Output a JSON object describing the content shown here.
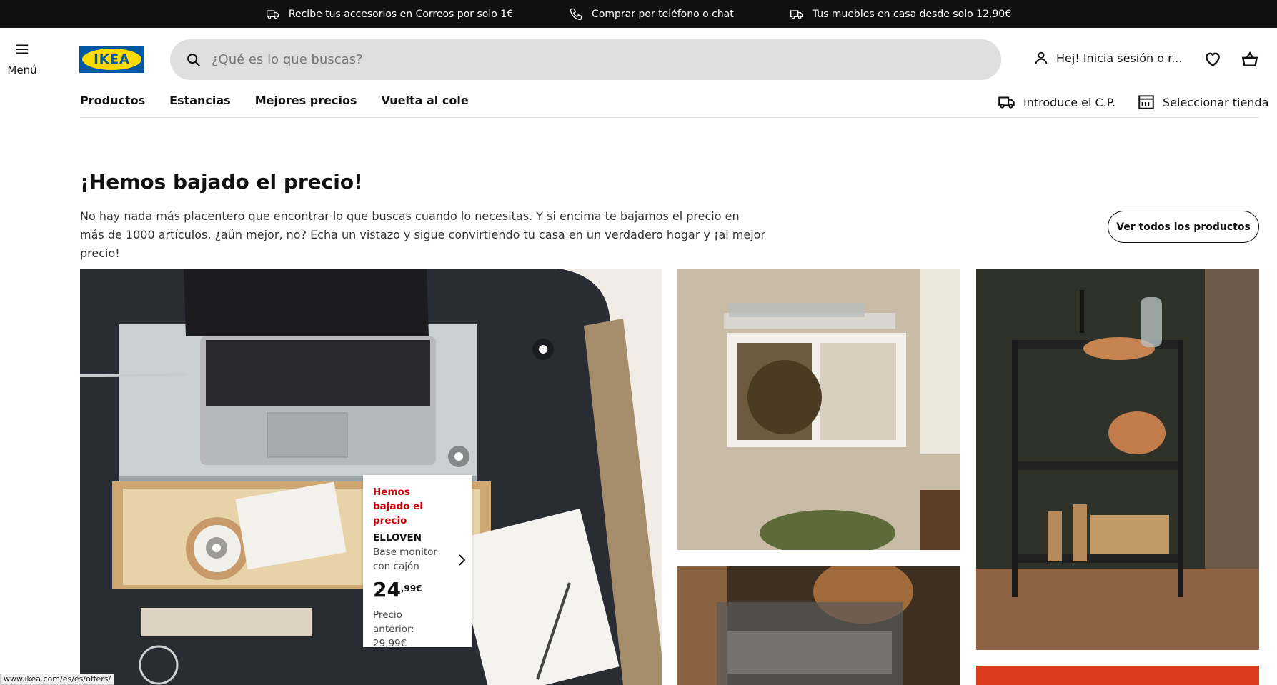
{
  "topbar": {
    "messages": [
      {
        "icon": "truck-icon",
        "text": "Recibe tus accesorios en Correos por solo 1€"
      },
      {
        "icon": "phone-icon",
        "text": "Comprar por teléfono o chat"
      },
      {
        "icon": "truck-icon",
        "text": "Tus muebles en casa desde solo 12,90€"
      }
    ]
  },
  "header": {
    "menu_label": "Menú",
    "logo_text": "IKEA",
    "search_placeholder": "¿Qué es lo que buscas?",
    "account_label": "Hej! Inicia sesión o r...",
    "icons": [
      "menu-icon",
      "search-icon",
      "user-icon",
      "heart-icon",
      "basket-icon"
    ]
  },
  "nav": {
    "items": [
      "Productos",
      "Estancias",
      "Mejores precios",
      "Vuelta al cole"
    ],
    "postcode_label": "Introduce el C.P.",
    "store_label": "Seleccionar tienda"
  },
  "hero": {
    "title": "¡Hemos bajado el precio!",
    "text": "No hay nada más placentero que encontrar lo que buscas cuando lo necesitas. Y si encima te bajamos el precio en más de 1000 artículos, ¿aún mejor, no? Echa un vistazo y sigue convirtiendo tu casa en un verdadero hogar y ¡al mejor precio!",
    "button_label": "Ver todos los productos"
  },
  "product_tag": {
    "badge": "Hemos bajado el precio",
    "name": "ELLOVEN",
    "description": "Base monitor con cajón",
    "price_int": "24",
    "price_dec": ",99€",
    "previous_price": "Precio anterior: 29,99€"
  },
  "status_url": "www.ikea.com/es/es/offers/",
  "colors": {
    "ikea_blue": "#0058a3",
    "ikea_yellow": "#ffdb00",
    "sale_red": "#cc0008",
    "topbar": "#111111"
  }
}
